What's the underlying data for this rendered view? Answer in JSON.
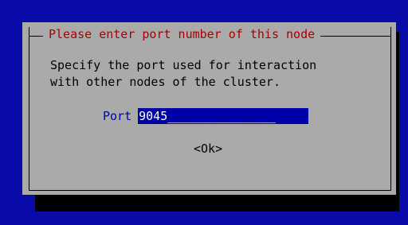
{
  "dialog": {
    "title": "Please enter port number of this node",
    "message_line1": "Specify the port used for interaction",
    "message_line2": "with other nodes of the cluster.",
    "port_label": "Port",
    "port_value": "9045",
    "port_fill": "_______________",
    "ok_label": "<Ok>"
  },
  "colors": {
    "background": "#0a0aa8",
    "dialog": "#aaaaaa",
    "title_text": "#a80000",
    "field_bg": "#0000a8",
    "field_text": "#ffffff"
  }
}
